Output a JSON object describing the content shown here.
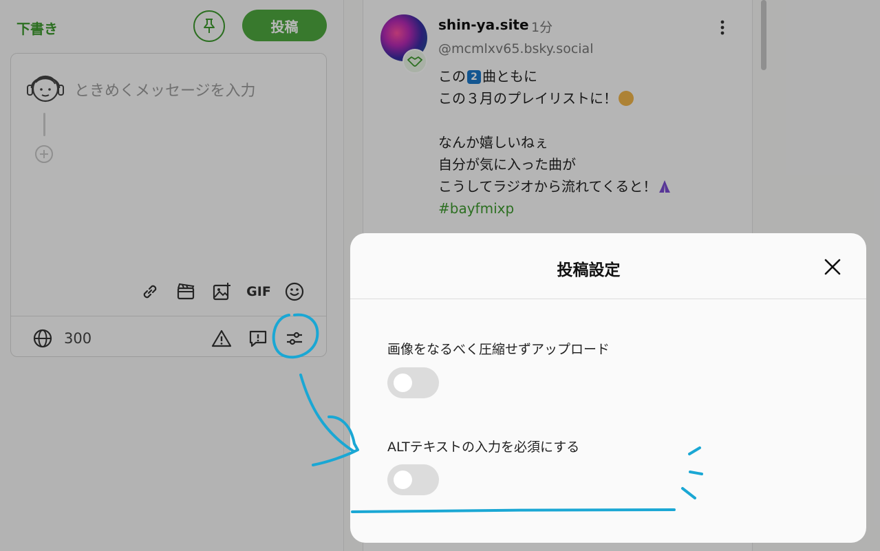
{
  "compose": {
    "draft_label": "下書き",
    "post_label": "投稿",
    "placeholder": "ときめくメッセージを入力",
    "gif_label": "GIF",
    "char_count": "300",
    "icons": [
      "pin-icon",
      "link-icon",
      "video-icon",
      "image-icon",
      "emoji-icon",
      "globe-icon",
      "warning-icon",
      "comment-icon",
      "settings-sliders-icon"
    ]
  },
  "feed": {
    "author": "shin-ya.site",
    "time": "1分",
    "handle": "@mcmlxv65.bsky.social",
    "line1_pre": "この",
    "line1_badge": "2",
    "line1_post": "曲ともに",
    "line2": "この３月のプレイリストに！",
    "line4": "なんか嬉しいねぇ",
    "line5": "自分が気に入った曲が",
    "line6": "こうしてラジオから流れてくると！",
    "hashtag": "#bayfmixp"
  },
  "modal": {
    "title": "投稿設定",
    "settings": [
      {
        "label": "画像をなるべく圧縮せずアップロード",
        "enabled": false
      },
      {
        "label": "ALTテキストの入力を必須にする",
        "enabled": false
      }
    ]
  },
  "colors": {
    "accent": "#3e9a2e",
    "annotation": "#1aa7d4",
    "toggle_off": "#dcdcdc"
  }
}
